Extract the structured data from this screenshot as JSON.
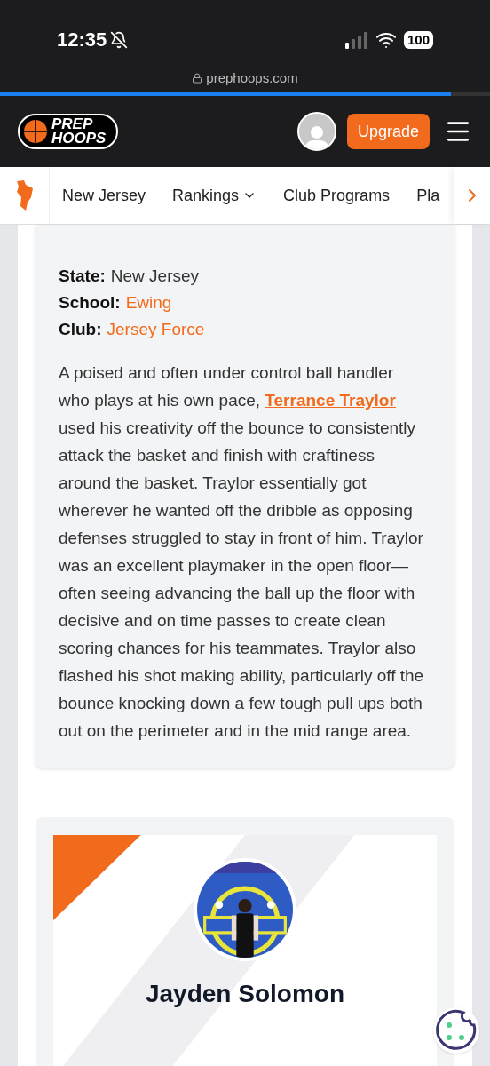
{
  "status_bar": {
    "time": "12:35",
    "battery": "100"
  },
  "browser": {
    "url": "prephoops.com",
    "loading": {
      "level": 0.92
    }
  },
  "header": {
    "logo_top": "PREP",
    "logo_bottom": "HOOPS",
    "upgrade_button": "Upgrade"
  },
  "nav": {
    "items": [
      {
        "label": "New Jersey",
        "dropdown": false
      },
      {
        "label": "Rankings",
        "dropdown": true
      },
      {
        "label": "Club Programs",
        "dropdown": false
      },
      {
        "label": "Pla",
        "dropdown": false
      }
    ]
  },
  "profile": {
    "facts": [
      {
        "label": "State:",
        "value": "New Jersey",
        "link": false
      },
      {
        "label": "School:",
        "value": "Ewing",
        "link": true
      },
      {
        "label": "Club:",
        "value": "Jersey Force",
        "link": true
      }
    ],
    "text_before": "A poised and often under control ball handler who plays at his own pace,",
    "link": "Terrance Traylor",
    "text_after": "used his creativity off the bounce to consistently attack the basket and finish with craftiness around the basket. Traylor essentially got wherever he wanted off the dribble as opposing defenses struggled to stay in front of him. Traylor was an excellent playmaker in the open floor— often seeing advancing the ball up the floor with decisive and on time passes to create clean scoring chances for his teammates. Traylor also flashed his shot making ability, particularly off the bounce knocking down a few tough pull ups both out on the perimeter and in the mid range area."
  },
  "next_player": {
    "name": "Jayden Solomon"
  }
}
